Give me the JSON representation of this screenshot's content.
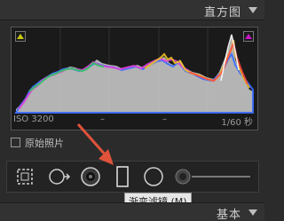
{
  "panel": {
    "title": "直方图"
  },
  "histogram": {
    "exif": {
      "iso": "ISO 3200",
      "sep1": "–",
      "sep2": "–",
      "shutter": "1/60 秒"
    },
    "shadow_clip_color": "#c8c814",
    "highlight_clip_color": "#c814c8"
  },
  "original_photo": {
    "label": "原始照片"
  },
  "tooltip": {
    "text": "渐变滤镜 (M)"
  },
  "bottom_panel": {
    "title": "基本"
  },
  "colors": {
    "accent_arrow": "#e0523a"
  }
}
